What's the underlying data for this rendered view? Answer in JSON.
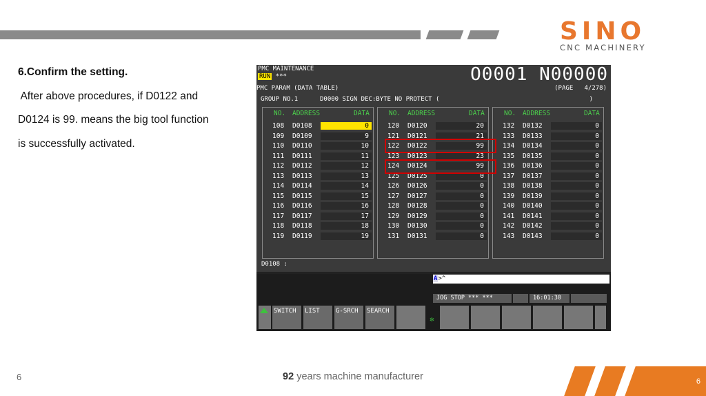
{
  "slide": {
    "heading": "6.Confirm the setting.",
    "paragraph_line1": " After above procedures, if D0122 and",
    "paragraph_line2": "D0124 is 99. means the big tool function",
    "paragraph_line3": "is successfully activated.",
    "page_number": "6",
    "footer_bold": "92",
    "footer_rest": " years machine manufacturer",
    "corner_number": "6"
  },
  "logo": {
    "word": "SINO",
    "subtitle": "CNC MACHINERY",
    "color": "#e8772e"
  },
  "screen": {
    "title": "PMC MAINTENANCE",
    "run_label": "RUN",
    "run_suffix": " ***",
    "program": "O0001 N00000",
    "subtitle": "PMC PARAM (DATA TABLE)",
    "page": "(PAGE   4/278)",
    "group": "GROUP NO.1",
    "group_info": "D0000 SIGN DEC:BYTE NO PROTECT (",
    "group_close": ")",
    "headers": {
      "no": "NO.",
      "address": "ADDRESS",
      "data": "DATA"
    },
    "columns": [
      {
        "rows": [
          {
            "no": "108",
            "addr": "D0108",
            "val": "0"
          },
          {
            "no": "109",
            "addr": "D0109",
            "val": "9"
          },
          {
            "no": "110",
            "addr": "D0110",
            "val": "10"
          },
          {
            "no": "111",
            "addr": "D0111",
            "val": "11"
          },
          {
            "no": "112",
            "addr": "D0112",
            "val": "12"
          },
          {
            "no": "113",
            "addr": "D0113",
            "val": "13"
          },
          {
            "no": "114",
            "addr": "D0114",
            "val": "14"
          },
          {
            "no": "115",
            "addr": "D0115",
            "val": "15"
          },
          {
            "no": "116",
            "addr": "D0116",
            "val": "16"
          },
          {
            "no": "117",
            "addr": "D0117",
            "val": "17"
          },
          {
            "no": "118",
            "addr": "D0118",
            "val": "18"
          },
          {
            "no": "119",
            "addr": "D0119",
            "val": "19"
          }
        ]
      },
      {
        "rows": [
          {
            "no": "120",
            "addr": "D0120",
            "val": "20"
          },
          {
            "no": "121",
            "addr": "D0121",
            "val": "21"
          },
          {
            "no": "122",
            "addr": "D0122",
            "val": "99"
          },
          {
            "no": "123",
            "addr": "D0123",
            "val": "23"
          },
          {
            "no": "124",
            "addr": "D0124",
            "val": "99"
          },
          {
            "no": "125",
            "addr": "D0125",
            "val": "0"
          },
          {
            "no": "126",
            "addr": "D0126",
            "val": "0"
          },
          {
            "no": "127",
            "addr": "D0127",
            "val": "0"
          },
          {
            "no": "128",
            "addr": "D0128",
            "val": "0"
          },
          {
            "no": "129",
            "addr": "D0129",
            "val": "0"
          },
          {
            "no": "130",
            "addr": "D0130",
            "val": "0"
          },
          {
            "no": "131",
            "addr": "D0131",
            "val": "0"
          }
        ]
      },
      {
        "rows": [
          {
            "no": "132",
            "addr": "D0132",
            "val": "0"
          },
          {
            "no": "133",
            "addr": "D0133",
            "val": "0"
          },
          {
            "no": "134",
            "addr": "D0134",
            "val": "0"
          },
          {
            "no": "135",
            "addr": "D0135",
            "val": "0"
          },
          {
            "no": "136",
            "addr": "D0136",
            "val": "0"
          },
          {
            "no": "137",
            "addr": "D0137",
            "val": "0"
          },
          {
            "no": "138",
            "addr": "D0138",
            "val": "0"
          },
          {
            "no": "139",
            "addr": "D0139",
            "val": "0"
          },
          {
            "no": "140",
            "addr": "D0140",
            "val": "0"
          },
          {
            "no": "141",
            "addr": "D0141",
            "val": "0"
          },
          {
            "no": "142",
            "addr": "D0142",
            "val": "0"
          },
          {
            "no": "143",
            "addr": "D0143",
            "val": "0"
          }
        ]
      }
    ],
    "highlight_color": "#ffe400",
    "box_color": "#d10000",
    "command_line": "D0108 :",
    "input_prefix": "A",
    "input_text": ">^",
    "status_mode": "JOG  STOP *** ***",
    "status_time": "16:01:30",
    "softkeys": [
      "SWITCH",
      "LIST",
      "G-SRCH",
      "SEARCH"
    ]
  }
}
